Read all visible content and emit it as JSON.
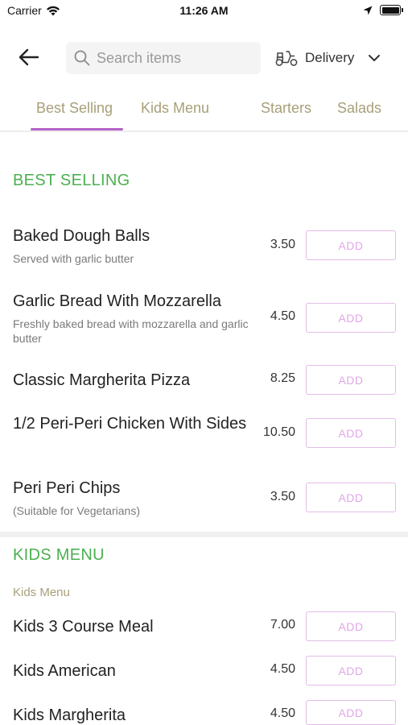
{
  "status_bar": {
    "carrier": "Carrier",
    "time": "11:26 AM"
  },
  "header": {
    "search_placeholder": "Search items",
    "delivery_label": "Delivery"
  },
  "tabs": [
    "Best Selling",
    "Kids Menu",
    "Starters",
    "Salads"
  ],
  "active_tab": "Best Selling",
  "sections": [
    {
      "heading": "BEST SELLING",
      "items": [
        {
          "name": "Baked Dough Balls",
          "description": "Served with garlic butter",
          "price": "3.50",
          "button": "ADD"
        },
        {
          "name": "Garlic Bread With Mozzarella",
          "description": "Freshly baked bread with mozzarella and garlic butter",
          "price": "4.50",
          "button": "ADD"
        },
        {
          "name": "Classic Margherita Pizza",
          "description": "",
          "price": "8.25",
          "button": "ADD"
        },
        {
          "name": "1/2 Peri-Peri Chicken With Sides",
          "description": "",
          "price": "10.50",
          "button": "ADD"
        },
        {
          "name": "Peri Peri Chips",
          "description": "(Suitable for Vegetarians)",
          "price": "3.50",
          "button": "ADD"
        }
      ]
    },
    {
      "heading": "KIDS MENU",
      "subheading": "Kids Menu",
      "items": [
        {
          "name": "Kids 3 Course Meal",
          "price": "7.00",
          "button": "ADD"
        },
        {
          "name": "Kids American",
          "price": "4.50",
          "button": "ADD"
        },
        {
          "name": "Kids Margherita",
          "price": "4.50",
          "button": "ADD"
        }
      ]
    }
  ],
  "colors": {
    "section_heading": "#4caf50",
    "tab_text": "#a89f78",
    "tab_indicator": "#b463c6",
    "add_button": "#e0a7e6"
  },
  "icons": {
    "back": "arrow-left-icon",
    "search": "search-icon",
    "delivery": "scooter-icon",
    "dropdown": "chevron-down-icon"
  }
}
